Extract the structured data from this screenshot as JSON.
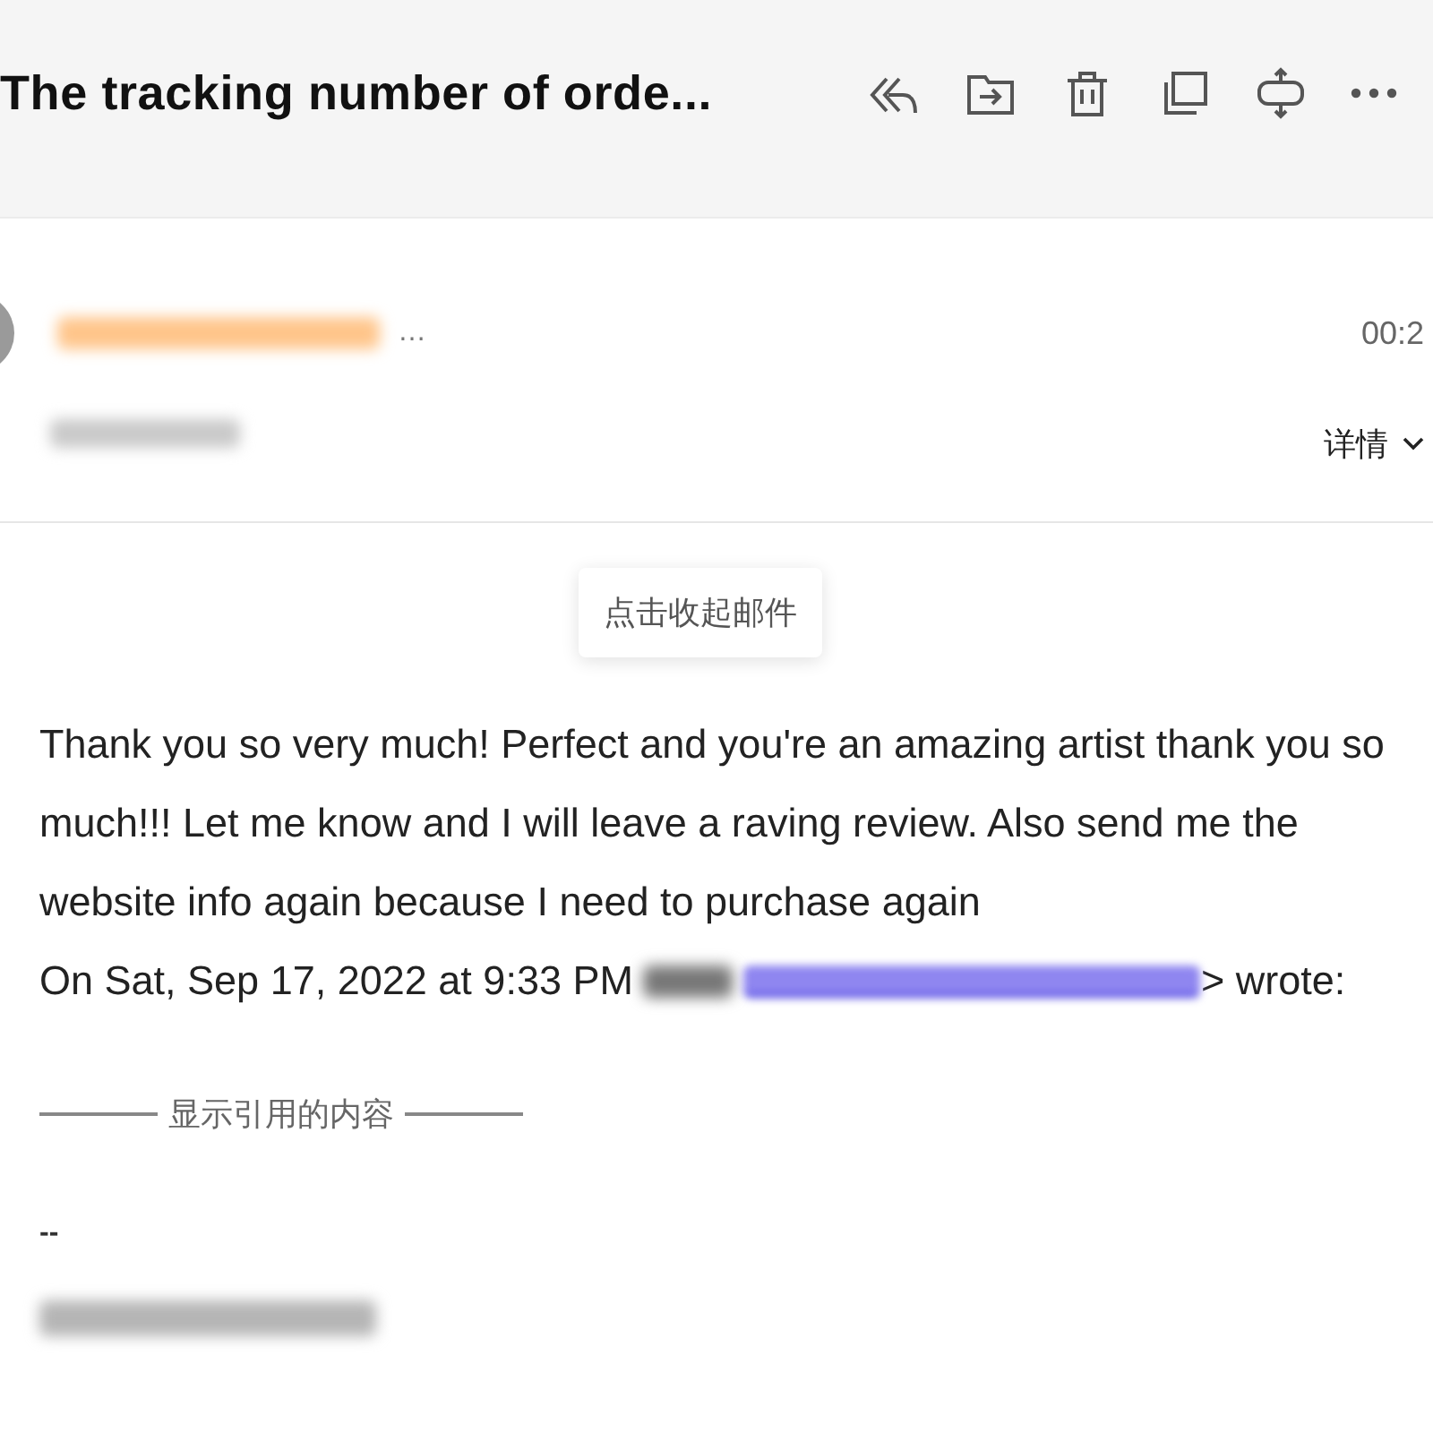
{
  "header": {
    "title": "The tracking number of orde..."
  },
  "sender": {
    "ellipsis": "…",
    "time": "00:2",
    "details_label": "详情"
  },
  "collapse_button": {
    "label": "点击收起邮件"
  },
  "message": {
    "body": "Thank you so very much! Perfect and you're an amazing artist thank you so much!!! Let me know and I will leave a raving review. Also send me the website info again because I need to purchase again",
    "quote_intro": "On Sat, Sep 17, 2022 at 9:33 PM",
    "quote_outro": "> wrote:",
    "show_quoted_label": "显示引用的内容",
    "signature_separator": "--"
  }
}
